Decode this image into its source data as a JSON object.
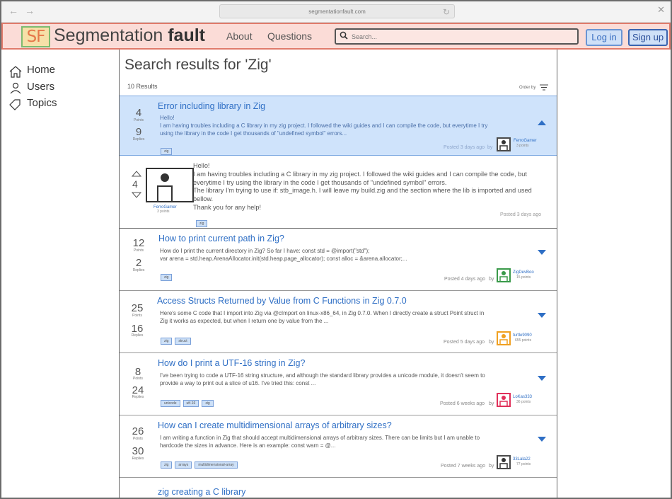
{
  "browser": {
    "url": "segmentationfault.com"
  },
  "header": {
    "logo_mark": "SF",
    "brand_light": "Segmentation ",
    "brand_bold": "fault",
    "nav": [
      "About",
      "Questions"
    ],
    "search_placeholder": "Search...",
    "login_label": "Log in",
    "signup_label": "Sign up"
  },
  "sidebar": {
    "items": [
      {
        "label": "Home",
        "icon": "home-icon"
      },
      {
        "label": "Users",
        "icon": "user-icon"
      },
      {
        "label": "Topics",
        "icon": "tag-icon"
      }
    ]
  },
  "main": {
    "title": "Search results for 'Zig'",
    "result_count": "10 Results",
    "order_by": "Order by",
    "points_label": "Points",
    "replies_label": "Replies",
    "by_label": "by",
    "questions": [
      {
        "title": "Error including library in Zig",
        "points": "4",
        "replies": "9",
        "excerpt": "Hello!\nI am having troubles including a C library in my zig project. I followed the wiki guides and I can compile the code, but everytime I try using the library in the code I get thousands of \"undefined symbol\" errors...",
        "tags": [
          "zig"
        ],
        "posted": "Posted 3 days ago",
        "user": {
          "name": "FerroGamer",
          "points": "3 points",
          "color": "#4a4a4a"
        }
      },
      {
        "title": "How to print current path in Zig?",
        "points": "12",
        "replies": "2",
        "excerpt": "How do I print the current directory in Zig? So far I have: const std = @import(\"std\");\nvar arena = std.heap.ArenaAllocator.init(std.heap.page_allocator); const alloc = &arena.allocator;...",
        "tags": [
          "zig"
        ],
        "posted": "Posted 4 days ago",
        "user": {
          "name": "ZigDevBoo",
          "points": "15 points",
          "color": "#3a9a4a"
        }
      },
      {
        "title": "Access Structs Returned by Value from C Functions in Zig 0.7.0",
        "points": "25",
        "replies": "16",
        "excerpt": "Here's some C code that I import into Zig via @cImport on linux-x86_64, in Zig 0.7.0. When I directly create a struct Point struct in Zig it works as expected, but when I return one by value from the ...",
        "tags": [
          "zig",
          "struct"
        ],
        "posted": "Posted 5 days ago",
        "user": {
          "name": "turtle9090",
          "points": "655 points",
          "color": "#f0a020"
        }
      },
      {
        "title": "How do I print a UTF-16 string in Zig?",
        "points": "8",
        "replies": "24",
        "excerpt": "I've been trying to code a UTF-16 string structure, and although the standard library provides a unicode module, it doesn't seem to provide a way to print out a slice of u16. I've tried this: const ...",
        "tags": [
          "unicode",
          "utf-16",
          "zig"
        ],
        "posted": "Posted 6 weeks ago",
        "user": {
          "name": "LoKas333",
          "points": "36 points",
          "color": "#e0305a"
        }
      },
      {
        "title": "How can I create multidimensional arrays of arbitrary sizes?",
        "points": "26",
        "replies": "30",
        "excerpt": "I am writing a function in Zig that should accept multidimensional arrays of arbitrary sizes. There can be limits but I am unable to hardcode the sizes in advance. Here is an example: const warn = @...",
        "tags": [
          "zig",
          "arrays",
          "multidimensional-array"
        ],
        "posted": "Posted 7 weeks ago",
        "user": {
          "name": "33Lala22",
          "points": "77 points",
          "color": "#4a4a4a"
        }
      },
      {
        "title": "zig creating a C library"
      }
    ],
    "expanded": {
      "votes": "4",
      "user": {
        "name": "FerroGamer",
        "points": "3 points"
      },
      "body": "Hello!\nI am having troubles including a C library in my zig project. I followed the wiki guides and I can compile the code, but everytime I try using the library in the code I get thousands of \"undefined symbol\" errors.\nThe library I'm trying to use if: stb_image.h. I will leave my build.zig and the section where the lib is imported and used bellow.\nThank you for any help!",
      "tags": [
        "zig"
      ],
      "posted": "Posted 3 days ago"
    }
  }
}
